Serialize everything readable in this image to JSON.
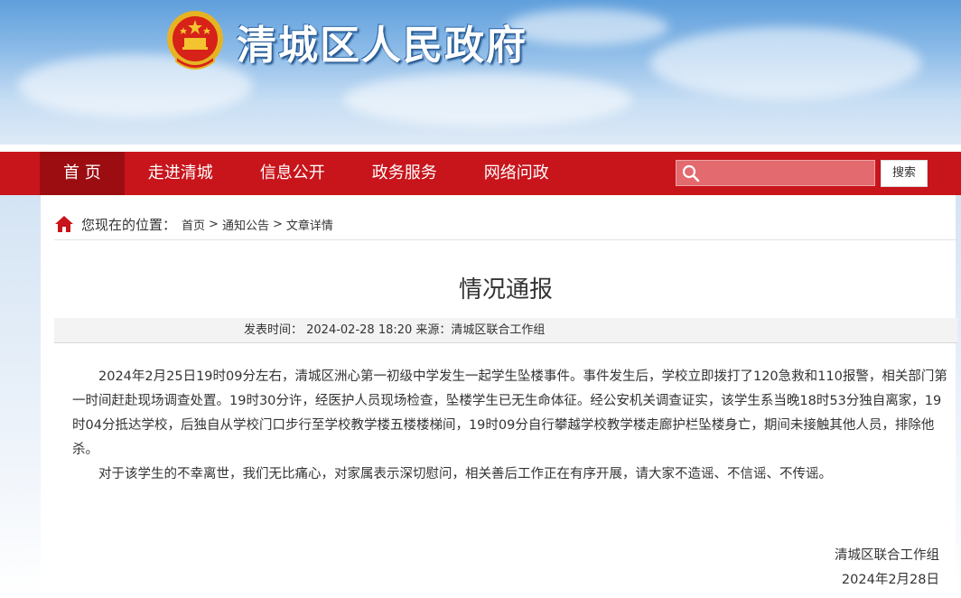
{
  "header": {
    "site_title": "清城区人民政府"
  },
  "nav": {
    "items": [
      {
        "label": "首 页",
        "active": true
      },
      {
        "label": "走进清城",
        "active": false
      },
      {
        "label": "信息公开",
        "active": false
      },
      {
        "label": "政务服务",
        "active": false
      },
      {
        "label": "网络问政",
        "active": false
      }
    ],
    "search_placeholder": "",
    "search_button": "搜索"
  },
  "breadcrumb": {
    "here_label": "您现在的位置：",
    "items": [
      "首页",
      "通知公告",
      "文章详情"
    ],
    "separator": ">"
  },
  "article": {
    "title": "情况通报",
    "meta": "发表时间： 2024-02-28 18:20 来源：清城区联合工作组",
    "paragraphs": [
      "2024年2月25日19时09分左右，清城区洲心第一初级中学发生一起学生坠楼事件。事件发生后，学校立即拨打了120急救和110报警，相关部门第一时间赶赴现场调查处置。19时30分许，经医护人员现场检查，坠楼学生已无生命体征。经公安机关调查证实，该学生系当晚18时53分独自离家，19时04分抵达学校，后独自从学校门口步行至学校教学楼五楼楼梯间，19时09分自行攀越学校教学楼走廊护栏坠楼身亡，期间未接触其他人员，排除他杀。",
      "对于该学生的不幸离世，我们无比痛心，对家属表示深切慰问，相关善后工作正在有序开展，请大家不造谣、不信谣、不传谣。"
    ],
    "signature_org": "清城区联合工作组",
    "signature_date": "2024年2月28日"
  },
  "colors": {
    "nav_red": "#c8141b",
    "nav_active": "#9c0d12",
    "banner_blue": "#5f9fdc"
  },
  "icons": [
    "national-emblem-icon",
    "search-icon",
    "home-icon"
  ]
}
